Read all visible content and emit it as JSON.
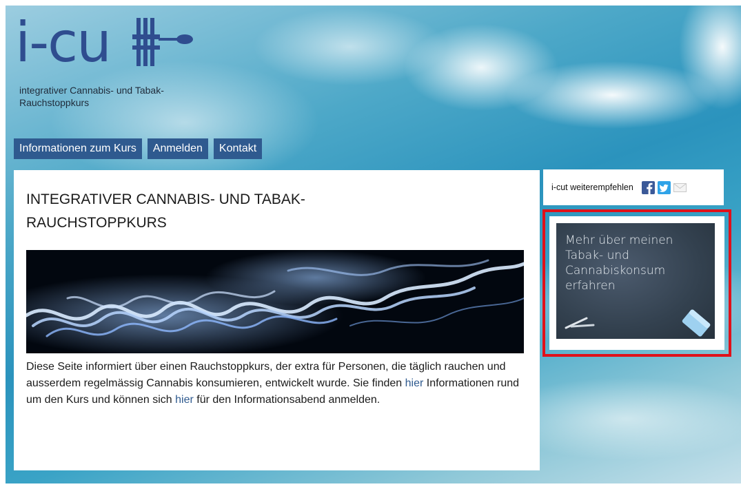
{
  "logo": {
    "wordmark": "i-cu",
    "subtitle_line1": "integrativer Cannabis- und Tabak-",
    "subtitle_line2": "Rauchstoppkurs"
  },
  "nav": {
    "items": [
      {
        "label": "Informationen zum Kurs"
      },
      {
        "label": "Anmelden"
      },
      {
        "label": "Kontakt"
      }
    ]
  },
  "main": {
    "title_line1": "INTEGRATIVER CANNABIS- UND TABAK-",
    "title_line2": "RAUCHSTOPPKURS",
    "intro_part1": "Diese Seite informiert über einen Rauchstoppkurs, der extra für Personen, die täglich rauchen und ausserdem regelmässig Cannabis konsumieren, entwickelt wurde. Sie finden ",
    "link1": "hier",
    "intro_part2": " Informationen rund um den Kurs und können sich ",
    "link2": "hier",
    "intro_part3": " für den Informationsabend anmelden."
  },
  "sidebar": {
    "share_label": "i-cut weiterempfehlen",
    "share_icons": [
      "facebook-icon",
      "twitter-icon",
      "email-icon"
    ],
    "promo": {
      "line1": "Mehr über meinen",
      "line2": "Tabak- und",
      "line3": "Cannabiskonsum",
      "line4": "erfahren"
    }
  },
  "colors": {
    "brand_blue": "#2f5a8f",
    "highlight_red": "#e0111a"
  }
}
